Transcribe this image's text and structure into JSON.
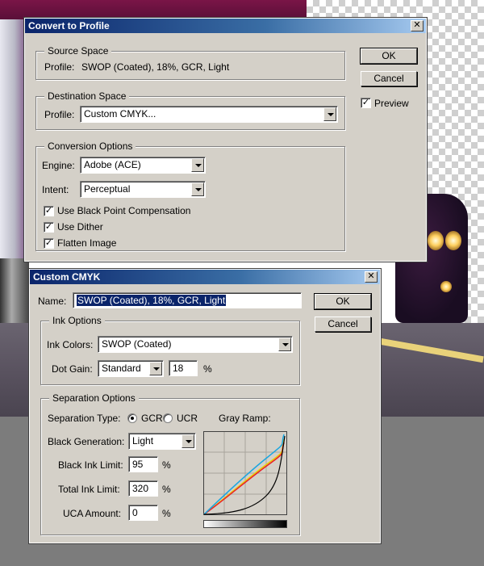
{
  "convert_dialog": {
    "title": "Convert to Profile",
    "source_space": {
      "label": "Source Space",
      "profile_label": "Profile:",
      "profile_value": "SWOP (Coated), 18%, GCR, Light"
    },
    "destination_space": {
      "label": "Destination Space",
      "profile_label": "Profile:",
      "profile_value": "Custom CMYK..."
    },
    "conversion_options": {
      "label": "Conversion Options",
      "engine_label": "Engine:",
      "engine_value": "Adobe (ACE)",
      "intent_label": "Intent:",
      "intent_value": "Perceptual",
      "black_point": {
        "label": "Use Black Point Compensation",
        "checked": true
      },
      "dither": {
        "label": "Use Dither",
        "checked": true
      },
      "flatten": {
        "label": "Flatten Image",
        "checked": true
      }
    },
    "ok_label": "OK",
    "cancel_label": "Cancel",
    "preview": {
      "label": "Preview",
      "checked": true
    }
  },
  "custom_cmyk_dialog": {
    "title": "Custom CMYK",
    "name_label": "Name:",
    "name_value": "SWOP (Coated), 18%, GCR, Light",
    "ok_label": "OK",
    "cancel_label": "Cancel",
    "ink_options": {
      "label": "Ink Options",
      "ink_colors_label": "Ink Colors:",
      "ink_colors_value": "SWOP (Coated)",
      "dot_gain_label": "Dot Gain:",
      "dot_gain_mode": "Standard",
      "dot_gain_value": "18",
      "dot_gain_unit": "%"
    },
    "separation_options": {
      "label": "Separation Options",
      "type_label": "Separation Type:",
      "gcr_label": "GCR",
      "ucr_label": "UCR",
      "selected_type": "GCR",
      "gray_ramp_label": "Gray Ramp:",
      "black_generation_label": "Black Generation:",
      "black_generation_value": "Light",
      "black_ink_limit_label": "Black Ink Limit:",
      "black_ink_limit_value": "95",
      "total_ink_limit_label": "Total Ink Limit:",
      "total_ink_limit_value": "320",
      "uca_amount_label": "UCA Amount:",
      "uca_amount_value": "0",
      "percent": "%"
    }
  },
  "colors": {
    "titlebar_start": "#0a246a",
    "titlebar_end": "#a6caf0",
    "dialog_face": "#d4d0c8",
    "selection": "#0a246a",
    "curve_cyan": "#1aa6e0",
    "curve_magenta": "#e8202a",
    "curve_yellow": "#e8d000",
    "curve_black": "#000000"
  }
}
